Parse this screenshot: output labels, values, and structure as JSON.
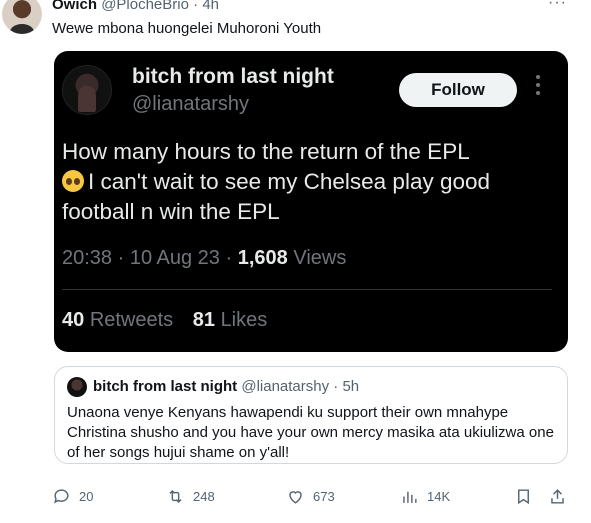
{
  "author": {
    "name": "Owich",
    "handle": "@PlocheBrio",
    "time": "4h",
    "separator": "·"
  },
  "tweet_text": "Wewe mbona huongelei Muhoroni Youth",
  "embedded_screenshot": {
    "name": "bitch from last night",
    "handle": "@lianatarshy",
    "follow_label": "Follow",
    "body_line1": "How many hours to the return of the EPL",
    "body_line2": "I can't wait to see my Chelsea play good football n win the EPL",
    "emoji_icon": "pleading-face-icon",
    "time": "20:38",
    "date": "10 Aug 23",
    "views_count": "1,608",
    "views_label": "Views",
    "retweets_count": "40",
    "retweets_label": "Retweets",
    "likes_count": "81",
    "likes_label": "Likes"
  },
  "quoted_tweet": {
    "name": "bitch from last night",
    "handle": "@lianatarshy",
    "time": "5h",
    "text": "Unaona venye Kenyans hawapendi ku support their own mnahype Christina shusho and you have your own mercy masika ata ukiulizwa one of her songs hujui shame on y'all!"
  },
  "actions": {
    "replies": "20",
    "retweets": "248",
    "likes": "673",
    "views": "14K"
  },
  "colors": {
    "text": "#0f1419",
    "muted": "#536471",
    "embed_bg": "#000000",
    "border": "#cfd9de"
  }
}
